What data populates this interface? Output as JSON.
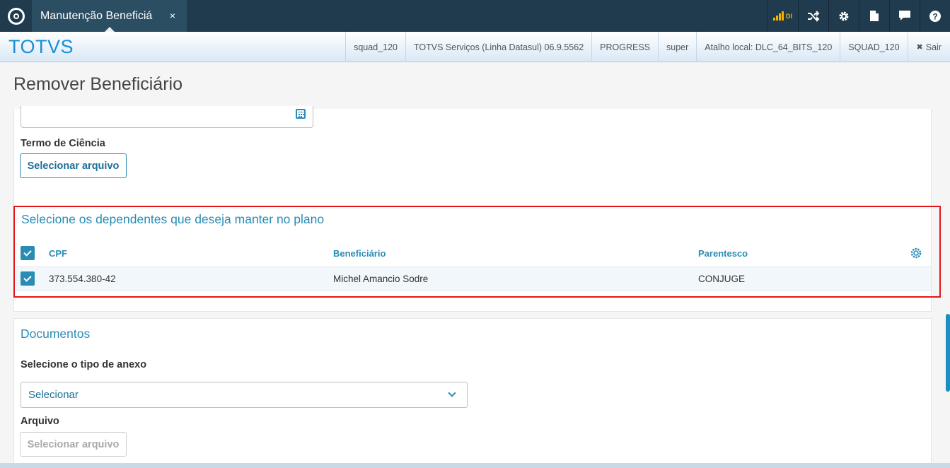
{
  "topbar": {
    "tab_label": "Manutenção Beneficiá",
    "tab_close": "×",
    "signal_label": "DI",
    "colors": {
      "bar": "#1f3b4d",
      "tab": "#2c4e63",
      "signal": "#f4b400"
    }
  },
  "brandbar": {
    "brand": "TOTVS",
    "infos": [
      "squad_120",
      "TOTVS Serviços (Linha Datasul) 06.9.5562",
      "PROGRESS",
      "super",
      "Atalho local: DLC_64_BITS_120",
      "SQUAD_120"
    ],
    "logout_icon": "✖",
    "logout_label": "Sair"
  },
  "page": {
    "title": "Remover Beneficiário"
  },
  "form": {
    "termo_label": "Termo de Ciência",
    "termo_button": "Selecionar arquivo"
  },
  "dependentes": {
    "title": "Selecione os dependentes que deseja manter no plano",
    "columns": [
      "CPF",
      "Beneficiário",
      "Parentesco"
    ],
    "rows": [
      {
        "cpf": "373.554.380-42",
        "beneficiario": "Michel Amancio Sodre",
        "parentesco": "CONJUGE",
        "checked": true
      }
    ]
  },
  "documentos": {
    "title": "Documentos",
    "tipo_label": "Selecione o tipo de anexo",
    "tipo_value": "Selecionar",
    "arquivo_label": "Arquivo",
    "arquivo_button": "Selecionar arquivo"
  },
  "accent_color": "#2a8cb5",
  "highlight_color": "#e3161b"
}
